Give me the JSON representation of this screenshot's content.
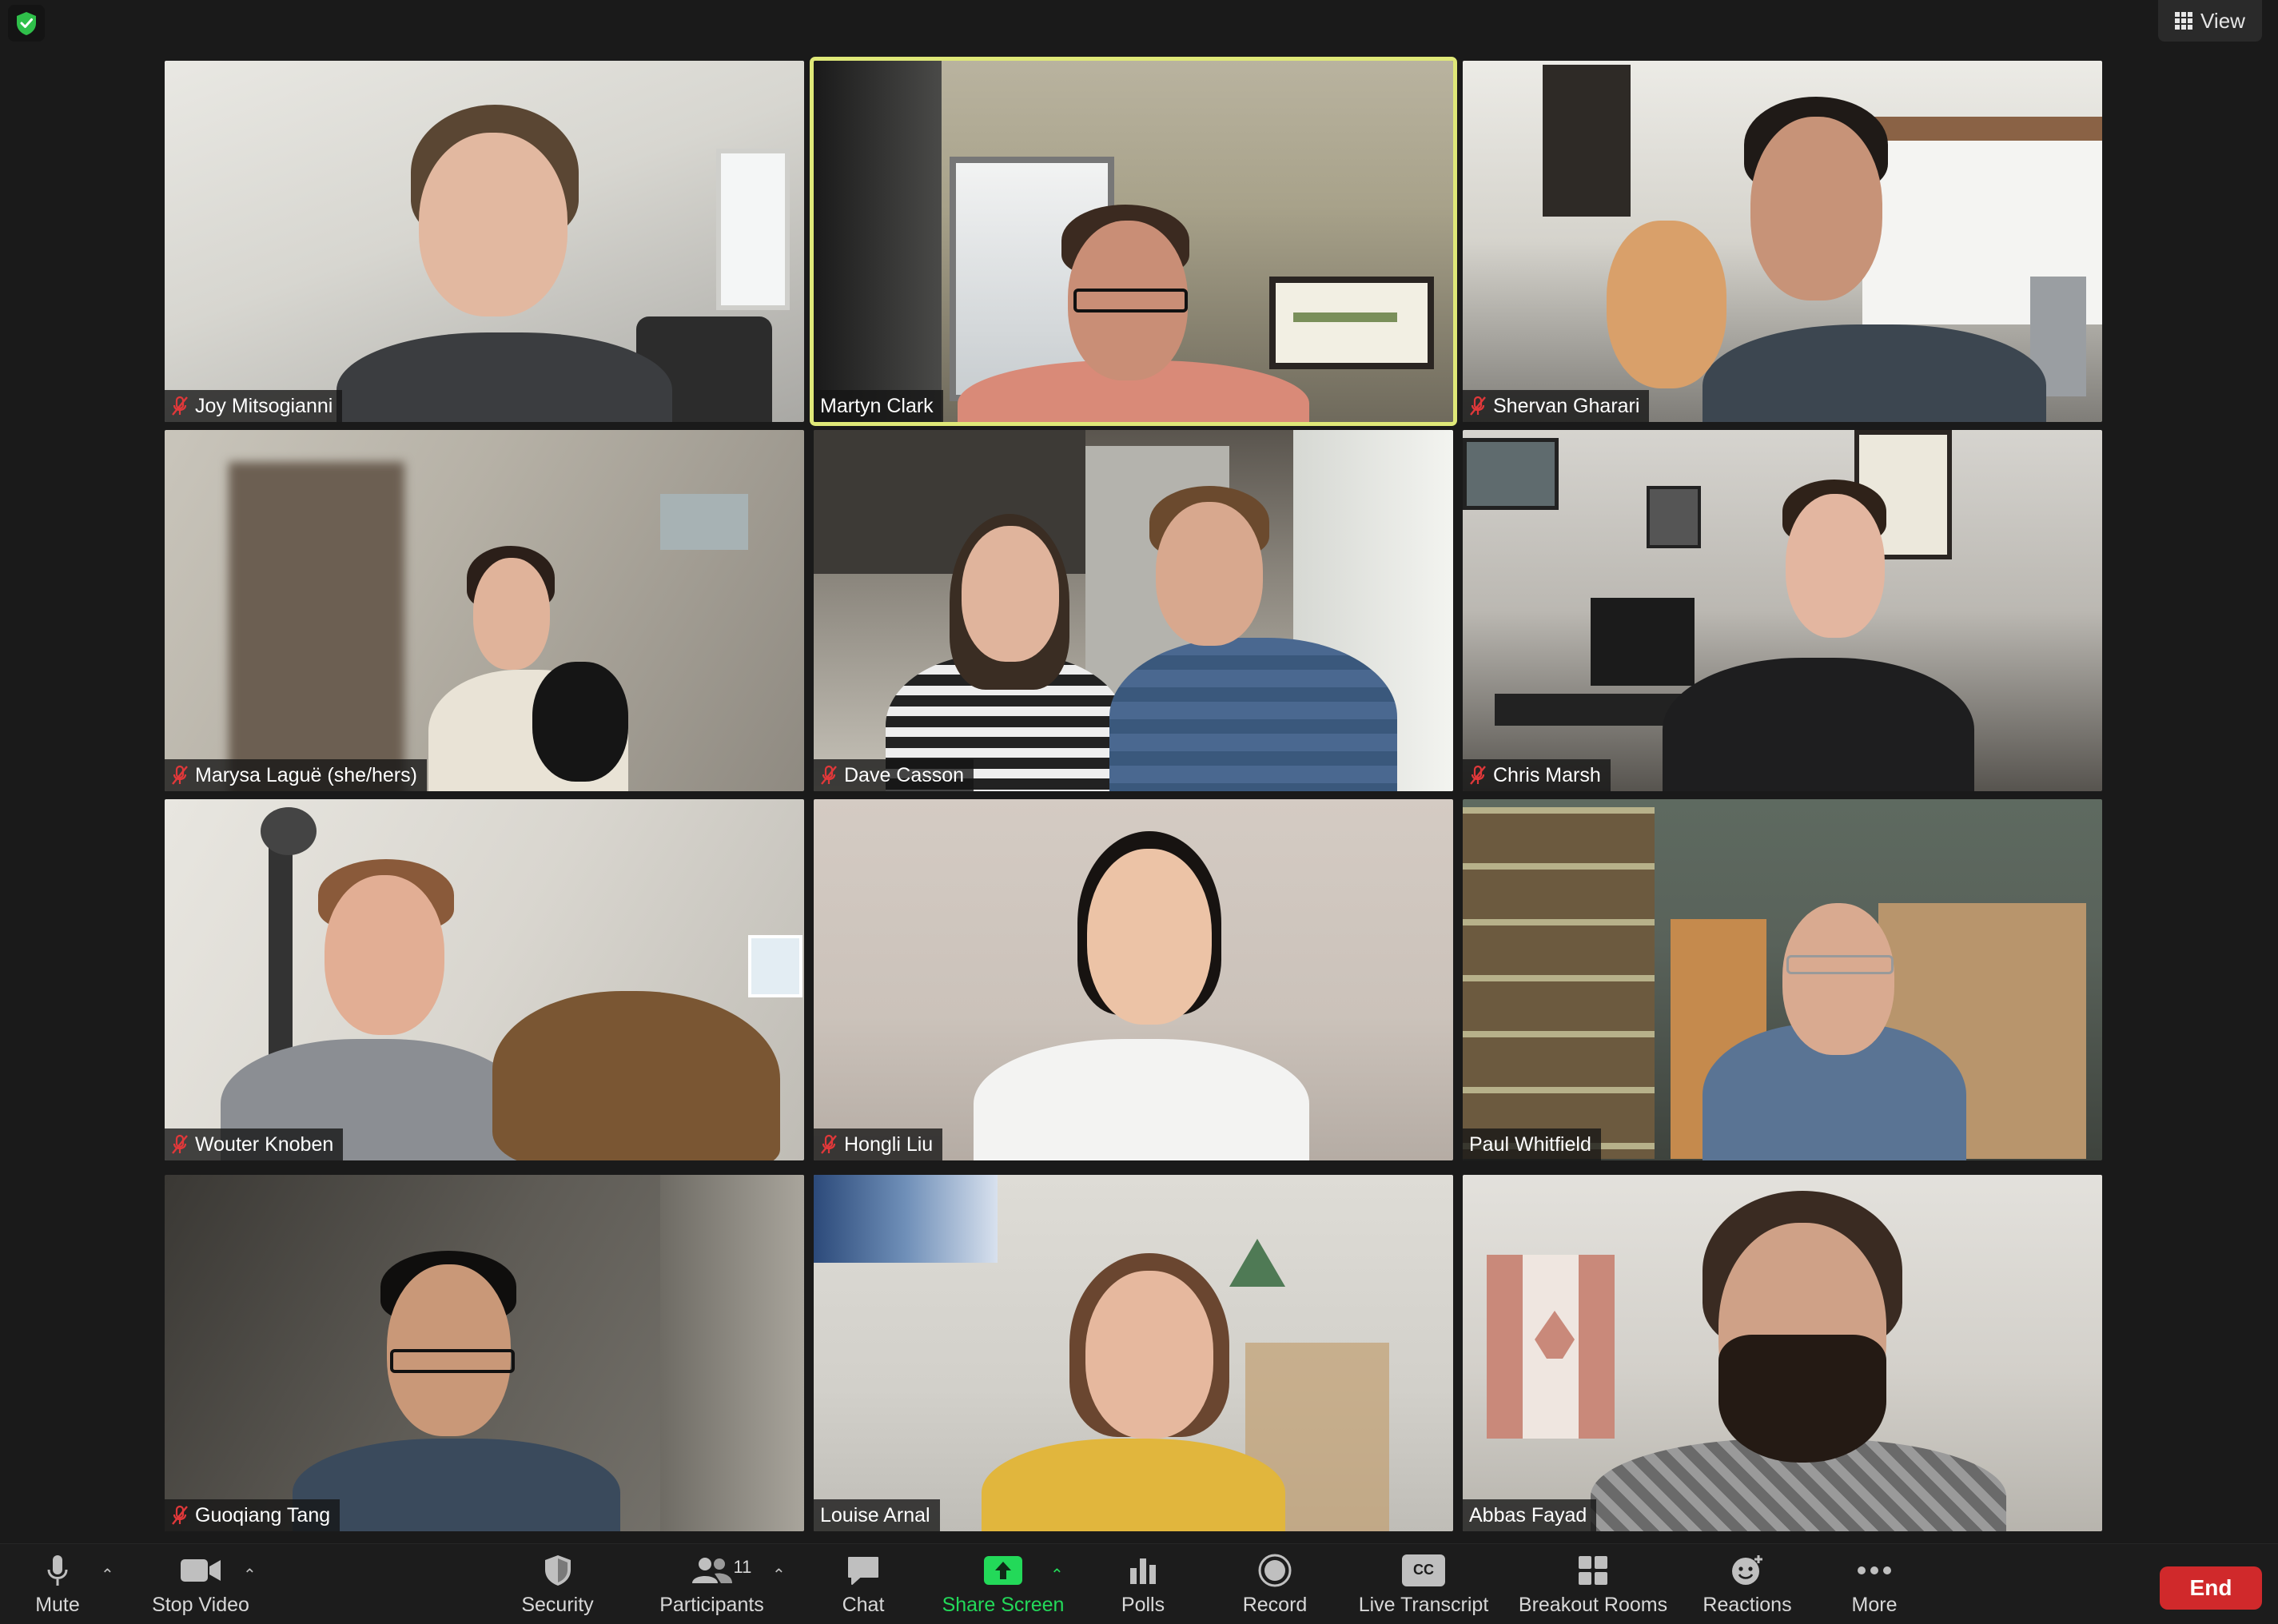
{
  "header": {
    "view_label": "View"
  },
  "participants": [
    {
      "name": "Joy Mitsogianni",
      "muted": true
    },
    {
      "name": "Martyn Clark",
      "muted": false,
      "active_speaker": true
    },
    {
      "name": "Shervan Gharari",
      "muted": true
    },
    {
      "name": "Marysa Laguë (she/hers)",
      "muted": true
    },
    {
      "name": "Dave Casson",
      "muted": true
    },
    {
      "name": "Chris Marsh",
      "muted": true
    },
    {
      "name": "Wouter Knoben",
      "muted": true
    },
    {
      "name": "Hongli Liu",
      "muted": true
    },
    {
      "name": "Paul Whitfield",
      "muted": false
    },
    {
      "name": "Guoqiang Tang",
      "muted": true
    },
    {
      "name": "Louise Arnal",
      "muted": false
    },
    {
      "name": "Abbas Fayad",
      "muted": false
    }
  ],
  "toolbar": {
    "mute": "Mute",
    "stop_video": "Stop Video",
    "security": "Security",
    "participants": "Participants",
    "participants_count": "11",
    "chat": "Chat",
    "share_screen": "Share Screen",
    "polls": "Polls",
    "record": "Record",
    "live_transcript": "Live Transcript",
    "cc_badge": "CC",
    "breakout_rooms": "Breakout Rooms",
    "reactions": "Reactions",
    "more": "More",
    "end": "End"
  },
  "colors": {
    "active_speaker_border": "#dfe878",
    "share_screen_green": "#23d959",
    "end_red": "#d0292b",
    "muted_red": "#e0383a"
  }
}
